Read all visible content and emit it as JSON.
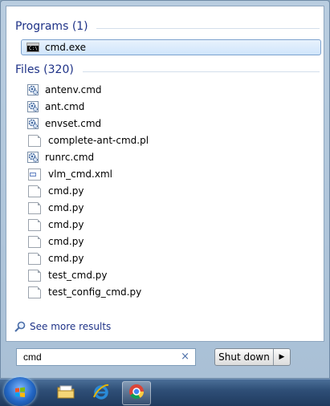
{
  "results": {
    "programs_header": "Programs (1)",
    "programs": [
      {
        "label": "cmd.exe",
        "icon": "command-prompt-icon",
        "selected": true
      }
    ],
    "files_header": "Files (320)",
    "files": [
      {
        "label": "antenv.cmd",
        "icon": "script-gear-icon"
      },
      {
        "label": "ant.cmd",
        "icon": "script-gear-icon"
      },
      {
        "label": "envset.cmd",
        "icon": "script-gear-icon"
      },
      {
        "label": "complete-ant-cmd.pl",
        "icon": "blank-file-icon"
      },
      {
        "label": "runrc.cmd",
        "icon": "script-gear-icon"
      },
      {
        "label": "vlm_cmd.xml",
        "icon": "xml-file-icon"
      },
      {
        "label": "cmd.py",
        "icon": "blank-file-icon"
      },
      {
        "label": "cmd.py",
        "icon": "blank-file-icon"
      },
      {
        "label": "cmd.py",
        "icon": "blank-file-icon"
      },
      {
        "label": "cmd.py",
        "icon": "blank-file-icon"
      },
      {
        "label": "cmd.py",
        "icon": "blank-file-icon"
      },
      {
        "label": "test_cmd.py",
        "icon": "blank-file-icon"
      },
      {
        "label": "test_config_cmd.py",
        "icon": "blank-file-icon"
      }
    ],
    "see_more": "See more results"
  },
  "search": {
    "value": "cmd",
    "clear_glyph": "×"
  },
  "shutdown": {
    "label": "Shut down",
    "arrow": "▶"
  },
  "taskbar": {
    "items": [
      {
        "name": "explorer-icon"
      },
      {
        "name": "internet-explorer-icon"
      },
      {
        "name": "chrome-icon",
        "active": true
      }
    ]
  },
  "colors": {
    "header_blue": "#1e3287",
    "selection_border": "#7da2ce"
  }
}
